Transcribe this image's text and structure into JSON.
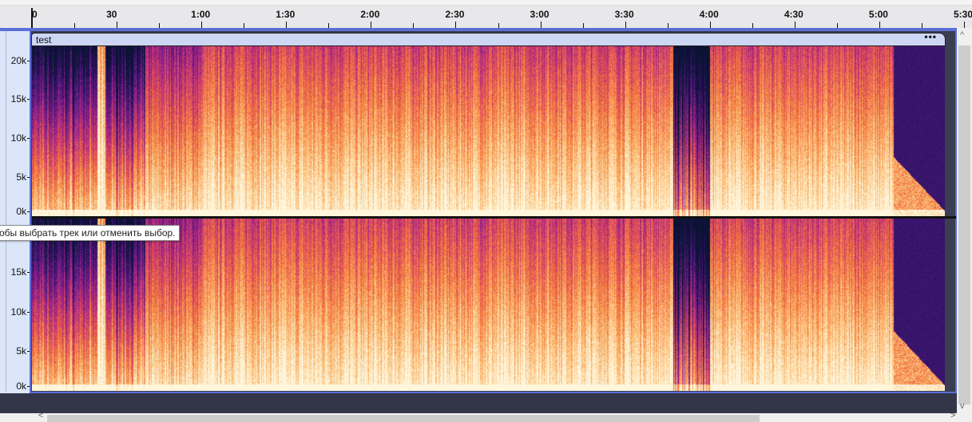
{
  "timeline": {
    "labels": [
      "0",
      "30",
      "1:00",
      "1:30",
      "2:00",
      "2:30",
      "3:00",
      "3:30",
      "4:00",
      "4:30",
      "5:00",
      "5:30"
    ],
    "seconds": [
      0,
      30,
      60,
      90,
      120,
      150,
      180,
      210,
      240,
      270,
      300,
      330
    ]
  },
  "track": {
    "clip_name": "test",
    "clip_menu": "•••",
    "channels": [
      {
        "freq_labels": [
          "20k",
          "15k",
          "10k",
          "5k",
          "0k"
        ],
        "freq_values": [
          20000,
          15000,
          10000,
          5000,
          0
        ]
      },
      {
        "freq_labels": [
          "15k",
          "10k",
          "5k",
          "0k"
        ],
        "freq_values": [
          15000,
          10000,
          5000,
          0
        ]
      }
    ],
    "view": "spectrogram",
    "colormap": [
      "#0b1233",
      "#3a1470",
      "#8a1e8c",
      "#d23c6a",
      "#f5793a",
      "#fbc27a",
      "#fff6dc"
    ]
  },
  "tooltip": {
    "text": "обы выбрать трек или отменить выбор."
  },
  "scrollbars": {
    "up": "^",
    "down": "v",
    "left": "<",
    "right": ">"
  }
}
